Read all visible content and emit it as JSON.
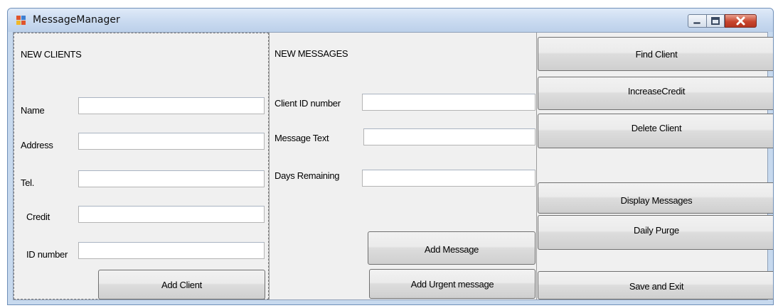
{
  "window": {
    "title": "MessageManager"
  },
  "title_controls": {
    "icons": [
      "minimize-icon",
      "maximize-icon",
      "close-icon"
    ]
  },
  "new_clients": {
    "heading": "NEW CLIENTS",
    "name_label": "Name",
    "name_value": "",
    "address_label": "Address",
    "address_value": "",
    "tel_label": "Tel.",
    "tel_value": "",
    "credit_label": "Credit",
    "credit_value": "",
    "id_label": "ID number",
    "id_value": "",
    "add_button": "Add Client"
  },
  "new_messages": {
    "heading": "NEW MESSAGES",
    "client_id_label": "Client ID number",
    "client_id_value": "",
    "message_text_label": "Message Text",
    "message_text_value": "",
    "days_remaining_label": "Days Remaining",
    "days_remaining_value": "",
    "add_message_button": "Add Message",
    "add_urgent_button": "Add Urgent message"
  },
  "actions": {
    "find_client": "Find Client",
    "increase_credit": "IncreaseCredit",
    "delete_client": "Delete Client",
    "display_messages": "Display Messages",
    "daily_purge": "Daily Purge",
    "save_exit": "Save and Exit"
  }
}
